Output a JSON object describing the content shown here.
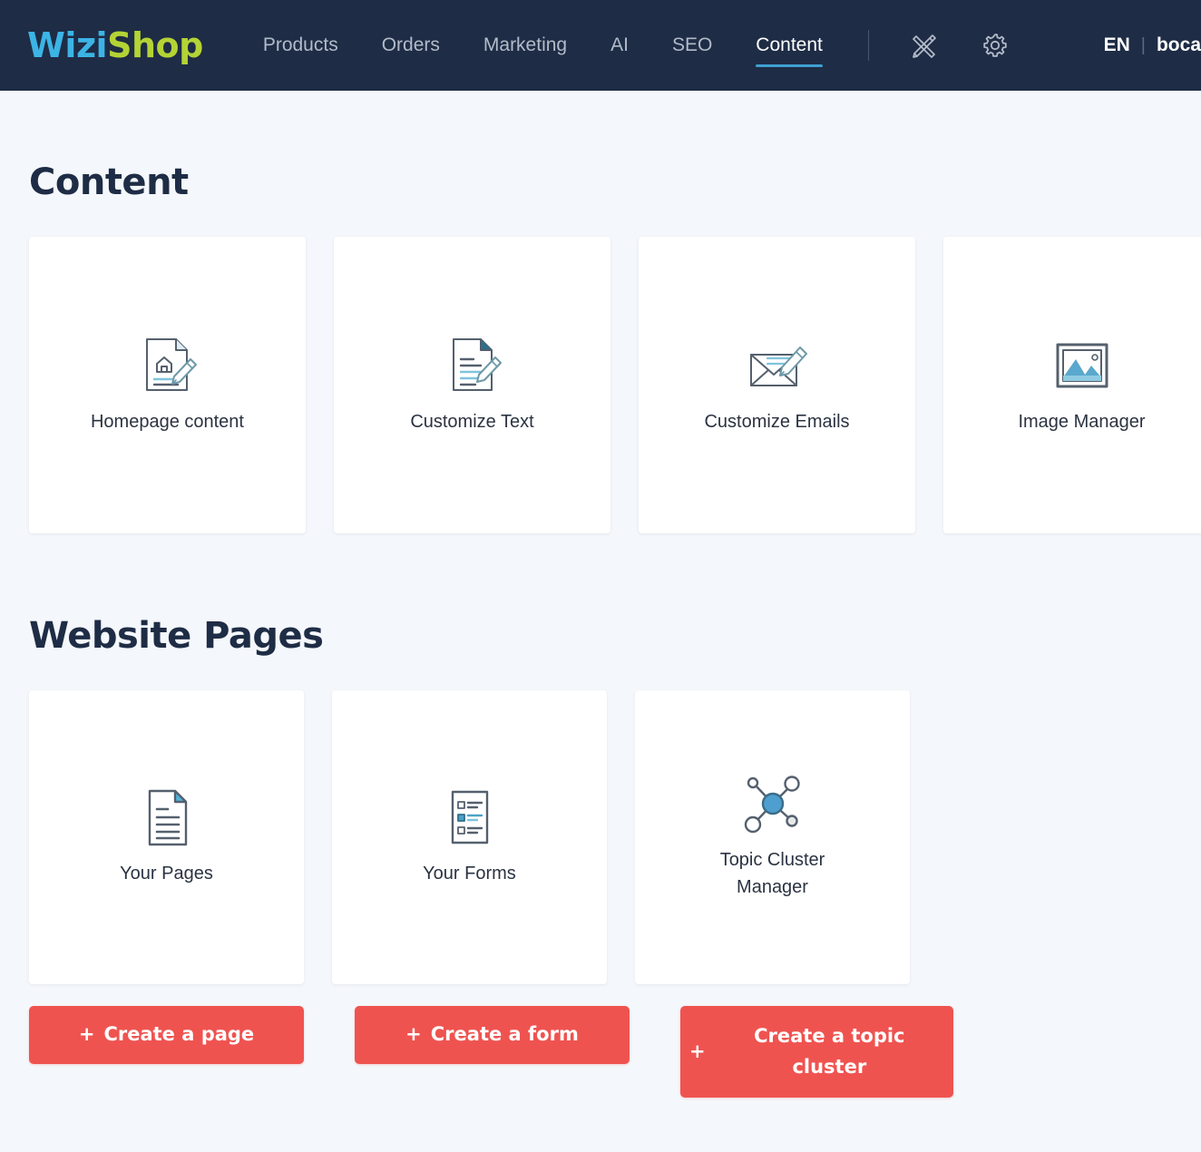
{
  "brand": {
    "name_part1": "Wizi",
    "name_part2": "Shop",
    "color_part1": "#3cb4e5",
    "color_part2": "#b4d335"
  },
  "topnav": {
    "items": [
      {
        "label": "Products",
        "active": false
      },
      {
        "label": "Orders",
        "active": false
      },
      {
        "label": "Marketing",
        "active": false
      },
      {
        "label": "AI",
        "active": false
      },
      {
        "label": "SEO",
        "active": false
      },
      {
        "label": "Content",
        "active": true
      }
    ],
    "icons": [
      {
        "name": "design-pencil-ruler-icon"
      },
      {
        "name": "gear-icon"
      }
    ],
    "language": "EN",
    "separator": "|",
    "account": "boca",
    "background_color": "#1e2c45",
    "active_underline_color": "#3f9fd0"
  },
  "content_section": {
    "title": "Content",
    "cards": [
      {
        "label": "Homepage content",
        "icon": "homepage-document-pencil-icon"
      },
      {
        "label": "Customize Text",
        "icon": "text-document-pencil-icon"
      },
      {
        "label": "Customize Emails",
        "icon": "envelope-pencil-icon"
      },
      {
        "label": "Image Manager",
        "icon": "image-frame-icon"
      }
    ]
  },
  "website_pages_section": {
    "title": "Website Pages",
    "cards": [
      {
        "label": "Your Pages",
        "icon": "document-icon"
      },
      {
        "label": "Your Forms",
        "icon": "form-checklist-icon"
      },
      {
        "label": "Topic Cluster Manager",
        "icon": "topic-cluster-network-icon"
      }
    ],
    "buttons": [
      {
        "plus": "+",
        "label": "Create a page"
      },
      {
        "plus": "+",
        "label": "Create a form"
      },
      {
        "plus": "+",
        "label": "Create a topic cluster"
      }
    ],
    "button_color": "#ef5350"
  },
  "theme": {
    "page_background": "#f4f7fb",
    "card_background": "#ffffff",
    "heading_color": "#1e2c45",
    "icon_accent_blue": "#4aa3c7"
  }
}
